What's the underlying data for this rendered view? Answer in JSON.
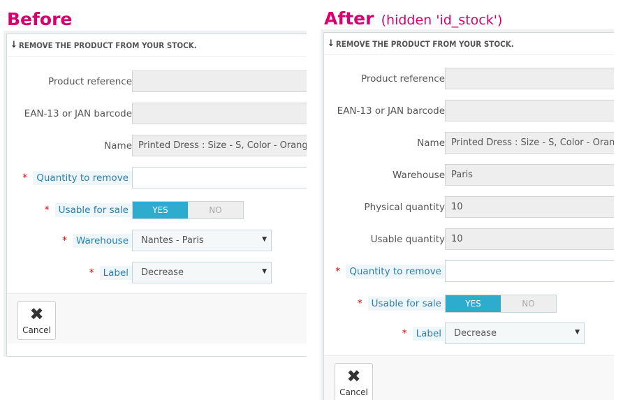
{
  "headings": {
    "before": "Before",
    "after": "After",
    "after_note": "(hidden 'id_stock')"
  },
  "before_panel": {
    "title": "REMOVE THE PRODUCT FROM YOUR STOCK.",
    "labels": {
      "product_reference": "Product reference",
      "ean13": "EAN-13 or JAN barcode",
      "name": "Name",
      "quantity_to_remove": "Quantity to remove",
      "usable_for_sale": "Usable for sale",
      "warehouse": "Warehouse",
      "label": "Label"
    },
    "values": {
      "product_reference": "",
      "ean13": "",
      "name": "Printed Dress : Size - S, Color - Orange",
      "quantity_to_remove": "",
      "warehouse": "Nantes - Paris",
      "label": "Decrease"
    },
    "toggle": {
      "yes": "YES",
      "no": "NO",
      "selected": "YES"
    },
    "cancel_label": "Cancel"
  },
  "after_panel": {
    "title": "REMOVE THE PRODUCT FROM YOUR STOCK.",
    "labels": {
      "product_reference": "Product reference",
      "ean13": "EAN-13 or JAN barcode",
      "name": "Name",
      "warehouse": "Warehouse",
      "physical_quantity": "Physical quantity",
      "usable_quantity": "Usable quantity",
      "quantity_to_remove": "Quantity to remove",
      "usable_for_sale": "Usable for sale",
      "label": "Label"
    },
    "values": {
      "product_reference": "",
      "ean13": "",
      "name": "Printed Dress : Size - S, Color - Orange",
      "warehouse": "Paris",
      "physical_quantity": "10",
      "usable_quantity": "10",
      "quantity_to_remove": "",
      "label": "Decrease"
    },
    "toggle": {
      "yes": "YES",
      "no": "NO",
      "selected": "YES"
    },
    "cancel_label": "Cancel"
  },
  "colors": {
    "heading": "#d6006e",
    "toggle_active": "#2eacce",
    "required_star": "#e50000",
    "required_label": "#2a7fad"
  },
  "icons": {
    "header": "arrow-down-icon",
    "cancel": "close-icon",
    "select": "caret-down-icon"
  }
}
